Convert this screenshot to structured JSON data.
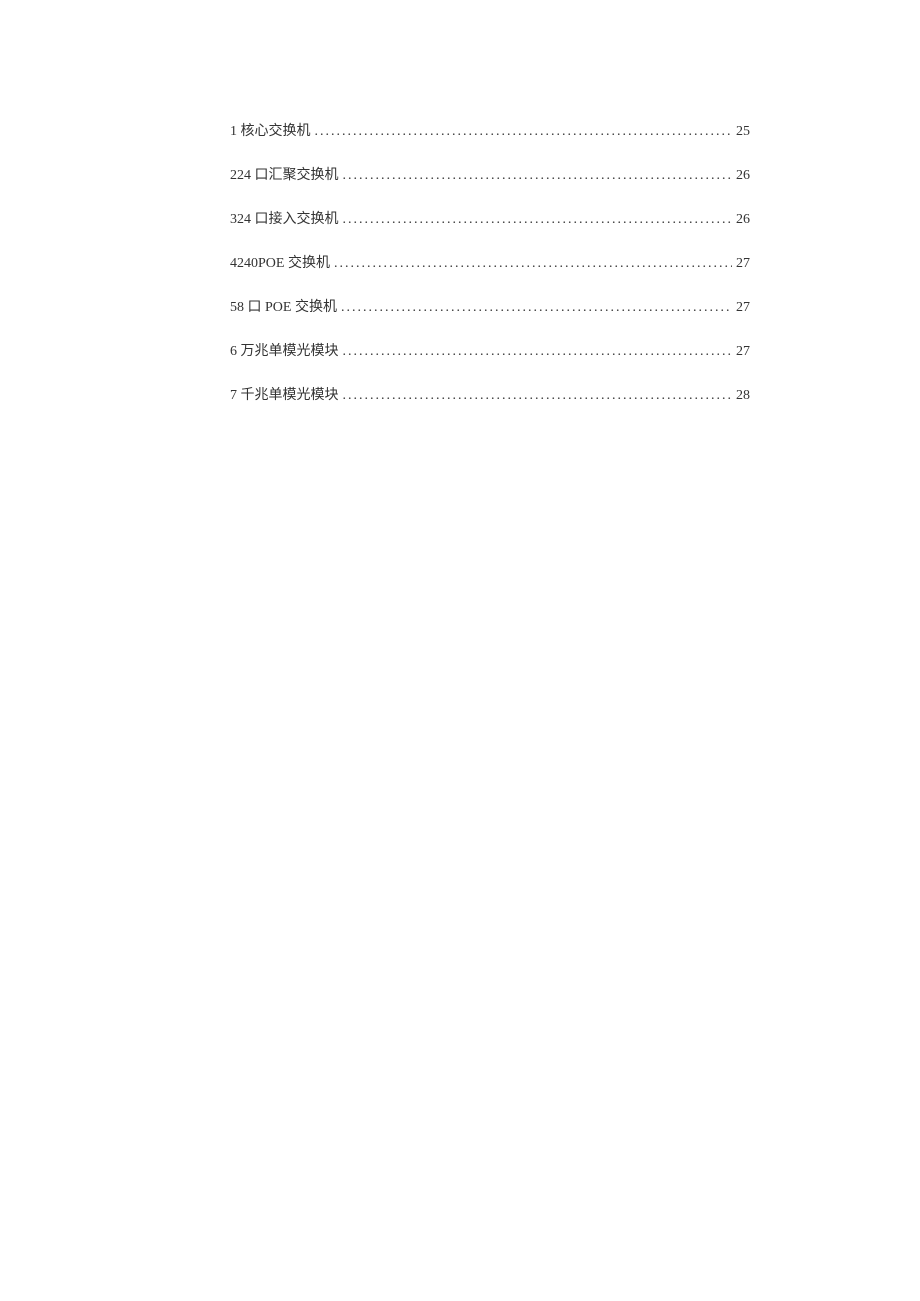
{
  "toc": {
    "entries": [
      {
        "title": "1 核心交换机",
        "page": "25"
      },
      {
        "title": "224 口汇聚交换机",
        "page": "26"
      },
      {
        "title": "324 口接入交换机",
        "page": "26"
      },
      {
        "title": "4240POE 交换机",
        "page": "27"
      },
      {
        "title": "58 口 POE 交换机",
        "page": "27"
      },
      {
        "title": "6 万兆单模光模块",
        "page": "27"
      },
      {
        "title": "7 千兆单模光模块",
        "page": "28"
      }
    ]
  }
}
